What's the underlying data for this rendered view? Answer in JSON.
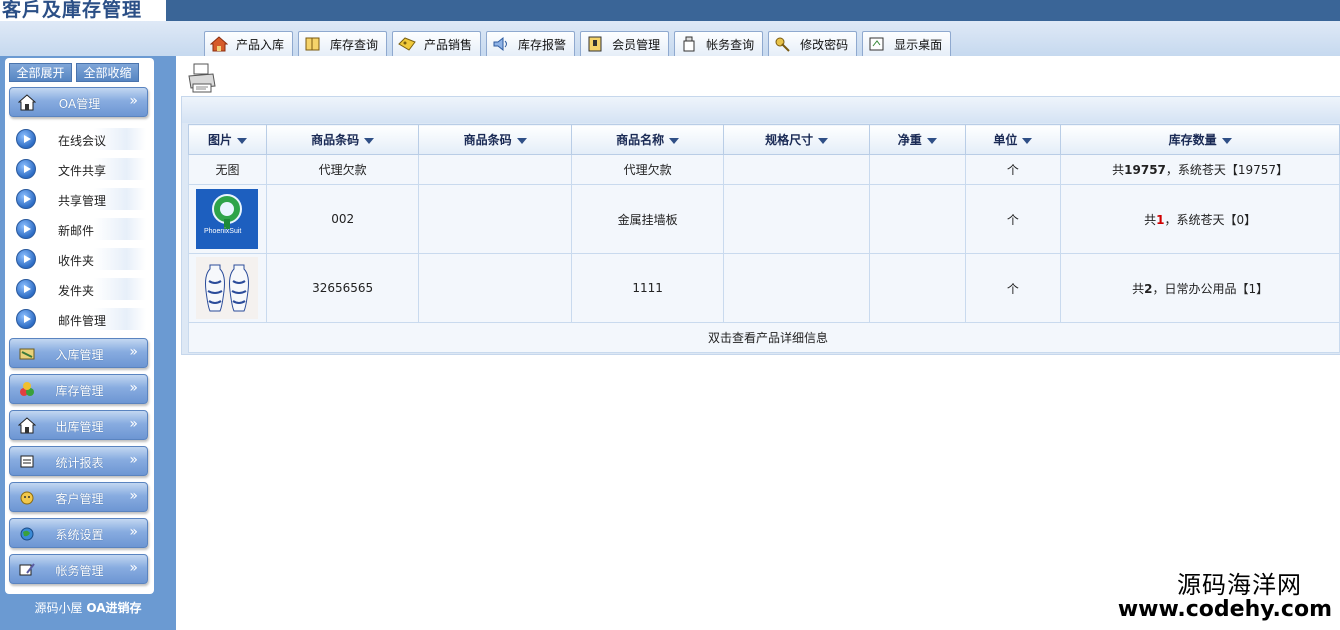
{
  "header": {
    "title": "客戶及庫存管理",
    "tabs": [
      {
        "label": "产品入库",
        "icon": "house-icon"
      },
      {
        "label": "库存查询",
        "icon": "book-icon"
      },
      {
        "label": "产品销售",
        "icon": "tag-icon"
      },
      {
        "label": "库存报警",
        "icon": "speaker-icon"
      },
      {
        "label": "会员管理",
        "icon": "member-card-icon"
      },
      {
        "label": "帐务查询",
        "icon": "tray-icon"
      },
      {
        "label": "修改密码",
        "icon": "key-icon"
      },
      {
        "label": "显示桌面",
        "icon": "desktop-icon"
      }
    ]
  },
  "sidebar": {
    "expand_all": "全部展开",
    "collapse_all": "全部收缩",
    "groups": [
      {
        "label": "OA管理",
        "icon": "house-icon",
        "expanded": true,
        "items": [
          "在线会议",
          "文件共享",
          "共享管理",
          "新邮件",
          "收件夹",
          "发件夹",
          "邮件管理"
        ]
      },
      {
        "label": "入库管理",
        "icon": "inbound-icon"
      },
      {
        "label": "库存管理",
        "icon": "stock-icon"
      },
      {
        "label": "出库管理",
        "icon": "house-icon"
      },
      {
        "label": "统计报表",
        "icon": "report-icon"
      },
      {
        "label": "客户管理",
        "icon": "customer-icon"
      },
      {
        "label": "系统设置",
        "icon": "globe-icon"
      },
      {
        "label": "帐务管理",
        "icon": "account-icon"
      }
    ],
    "chevron": "»",
    "footer_prefix": "源码小屋",
    "footer_bold": "OA进销存"
  },
  "grid": {
    "columns": [
      "图片",
      "商品条码",
      "商品条码",
      "商品名称",
      "规格尺寸",
      "净重",
      "单位",
      "库存数量"
    ],
    "rows": [
      {
        "image": "无图",
        "barcode": "代理欠款",
        "barcode2": "",
        "name": "代理欠款",
        "spec": "",
        "weight": "",
        "unit": "个",
        "stock_prefix": "共",
        "stock_count": "19757",
        "stock_suffix": "，系统苍天【19757】",
        "stock_highlight": false
      },
      {
        "image": "",
        "image_caption": "PhoenixSuit",
        "barcode": "002",
        "barcode2": "",
        "name": "金属挂墙板",
        "spec": "",
        "weight": "",
        "unit": "个",
        "stock_prefix": "共",
        "stock_count": "1",
        "stock_suffix": "，系统苍天【0】",
        "stock_highlight": true
      },
      {
        "image": "",
        "barcode": "32656565",
        "barcode2": "",
        "name": "1111",
        "spec": "",
        "weight": "",
        "unit": "个",
        "stock_prefix": "共",
        "stock_count": "2",
        "stock_suffix": "，日常办公用品【1】",
        "stock_highlight": false
      }
    ],
    "hint": "双击查看产品详细信息"
  },
  "watermark": {
    "line1": "源码海洋网",
    "line2": "www.codehy.com"
  }
}
